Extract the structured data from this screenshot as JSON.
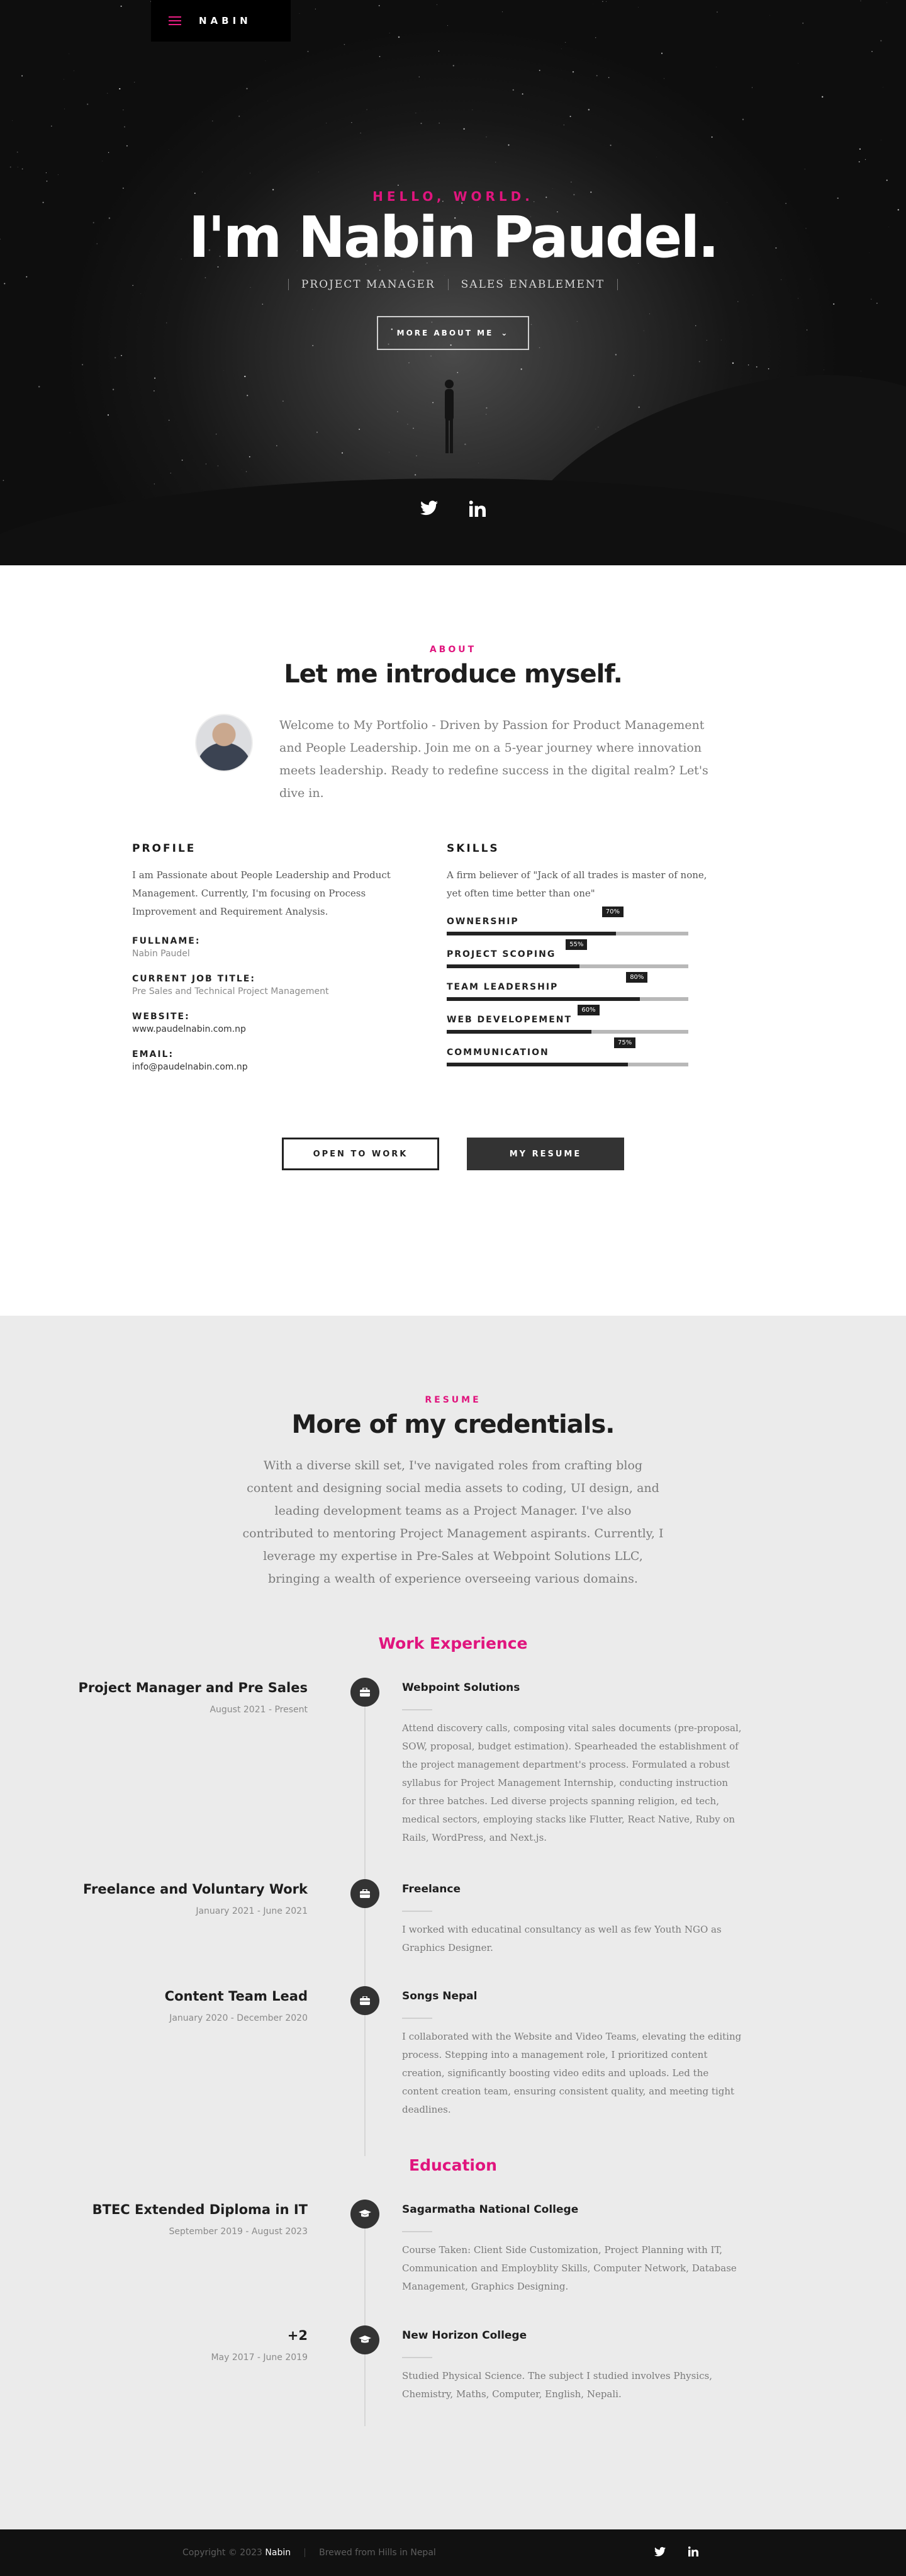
{
  "nav": {
    "logo": "NABIN"
  },
  "hero": {
    "greeting": "HELLO, WORLD.",
    "name": "I'm Nabin Paudel.",
    "roles": [
      "PROJECT MANAGER",
      "SALES ENABLEMENT"
    ],
    "cta_label": "MORE ABOUT ME",
    "social": [
      "twitter-icon",
      "linkedin-icon"
    ]
  },
  "about": {
    "label": "ABOUT",
    "title": "Let me introduce myself.",
    "intro": "Welcome to My Portfolio - Driven by Passion for Product Management and People Leadership. Join me on a 5-year journey where innovation meets leadership. Ready to redefine success in the digital realm? Let's dive in.",
    "profile": {
      "heading": "PROFILE",
      "text": "I am Passionate about People Leadership and Product Management. Currently, I'm focusing on Process Improvement and Requirement Analysis.",
      "fields": [
        {
          "key": "FULLNAME:",
          "value": "Nabin Paudel"
        },
        {
          "key": "CURRENT JOB TITLE:",
          "value": "Pre Sales and Technical Project Management"
        },
        {
          "key": "WEBSITE:",
          "value": "www.paudelnabin.com.np"
        },
        {
          "key": "EMAIL:",
          "value": "info@paudelnabin.com.np"
        }
      ]
    },
    "skills": {
      "heading": "SKILLS",
      "text": "A firm believer of \"Jack of all trades is master of none, yet often time better than one\"",
      "items": [
        {
          "name": "OWNERSHIP",
          "percent": 70,
          "label": "70%"
        },
        {
          "name": "PROJECT SCOPING",
          "percent": 55,
          "label": "55%"
        },
        {
          "name": "TEAM LEADERSHIP",
          "percent": 80,
          "label": "80%"
        },
        {
          "name": "WEB DEVELOPEMENT",
          "percent": 60,
          "label": "60%"
        },
        {
          "name": "COMMUNICATION",
          "percent": 75,
          "label": "75%"
        }
      ]
    },
    "buttons": {
      "open_to_work": "OPEN TO WORK",
      "resume": "MY RESUME"
    }
  },
  "resume": {
    "label": "RESUME",
    "title": "More of my credentials.",
    "intro": "With a diverse skill set, I've navigated roles from crafting blog content and designing social media assets to coding, UI design, and leading development teams as a Project Manager. I've also contributed to mentoring Project Management aspirants. Currently, I leverage my expertise in Pre-Sales at Webpoint Solutions LLC, bringing a wealth of experience overseeing various domains.",
    "work_title": "Work Experience",
    "work": [
      {
        "role": "Project Manager and Pre Sales",
        "date": "August 2021 - Present",
        "org": "Webpoint Solutions",
        "text": "Attend discovery calls, composing vital sales documents (pre-proposal, SOW, proposal, budget estimation). Spearheaded the establishment of the project management department's process. Formulated a robust syllabus for Project Management Internship, conducting instruction for three batches. Led diverse projects spanning religion, ed tech, medical sectors, employing stacks like Flutter, React Native, Ruby on Rails, WordPress, and Next.js."
      },
      {
        "role": "Freelance and Voluntary Work",
        "date": "January 2021 - June 2021",
        "org": "Freelance",
        "text": "I worked with educatinal consultancy as well as few Youth NGO as Graphics Designer."
      },
      {
        "role": "Content Team Lead",
        "date": "January 2020 - December 2020",
        "org": "Songs Nepal",
        "text": "I collaborated with the Website and Video Teams, elevating the editing process. Stepping into a management role, I prioritized content creation, significantly boosting video edits and uploads. Led the content creation team, ensuring consistent quality, and meeting tight deadlines."
      }
    ],
    "edu_title": "Education",
    "education": [
      {
        "role": "BTEC Extended Diploma in IT",
        "date": "September 2019 - August 2023",
        "org": "Sagarmatha National College",
        "text": "Course Taken: Client Side Customization, Project Planning with IT, Communication and Employblity Skills, Computer Network, Database Management, Graphics Designing."
      },
      {
        "role": "+2",
        "date": "May 2017 - June 2019",
        "org": "New Horizon College",
        "text": "Studied Physical Science. The subject I studied involves Physics, Chemistry, Maths, Computer, English, Nepali."
      }
    ]
  },
  "footer": {
    "copyright": "Copyright © 2023",
    "brand": "Nabin",
    "tagline": "Brewed from Hills in Nepal",
    "social": [
      "twitter-icon",
      "linkedin-icon"
    ]
  },
  "colors": {
    "accent": "#e0157e",
    "dark": "#111111",
    "resume_bg": "#ebebeb"
  }
}
